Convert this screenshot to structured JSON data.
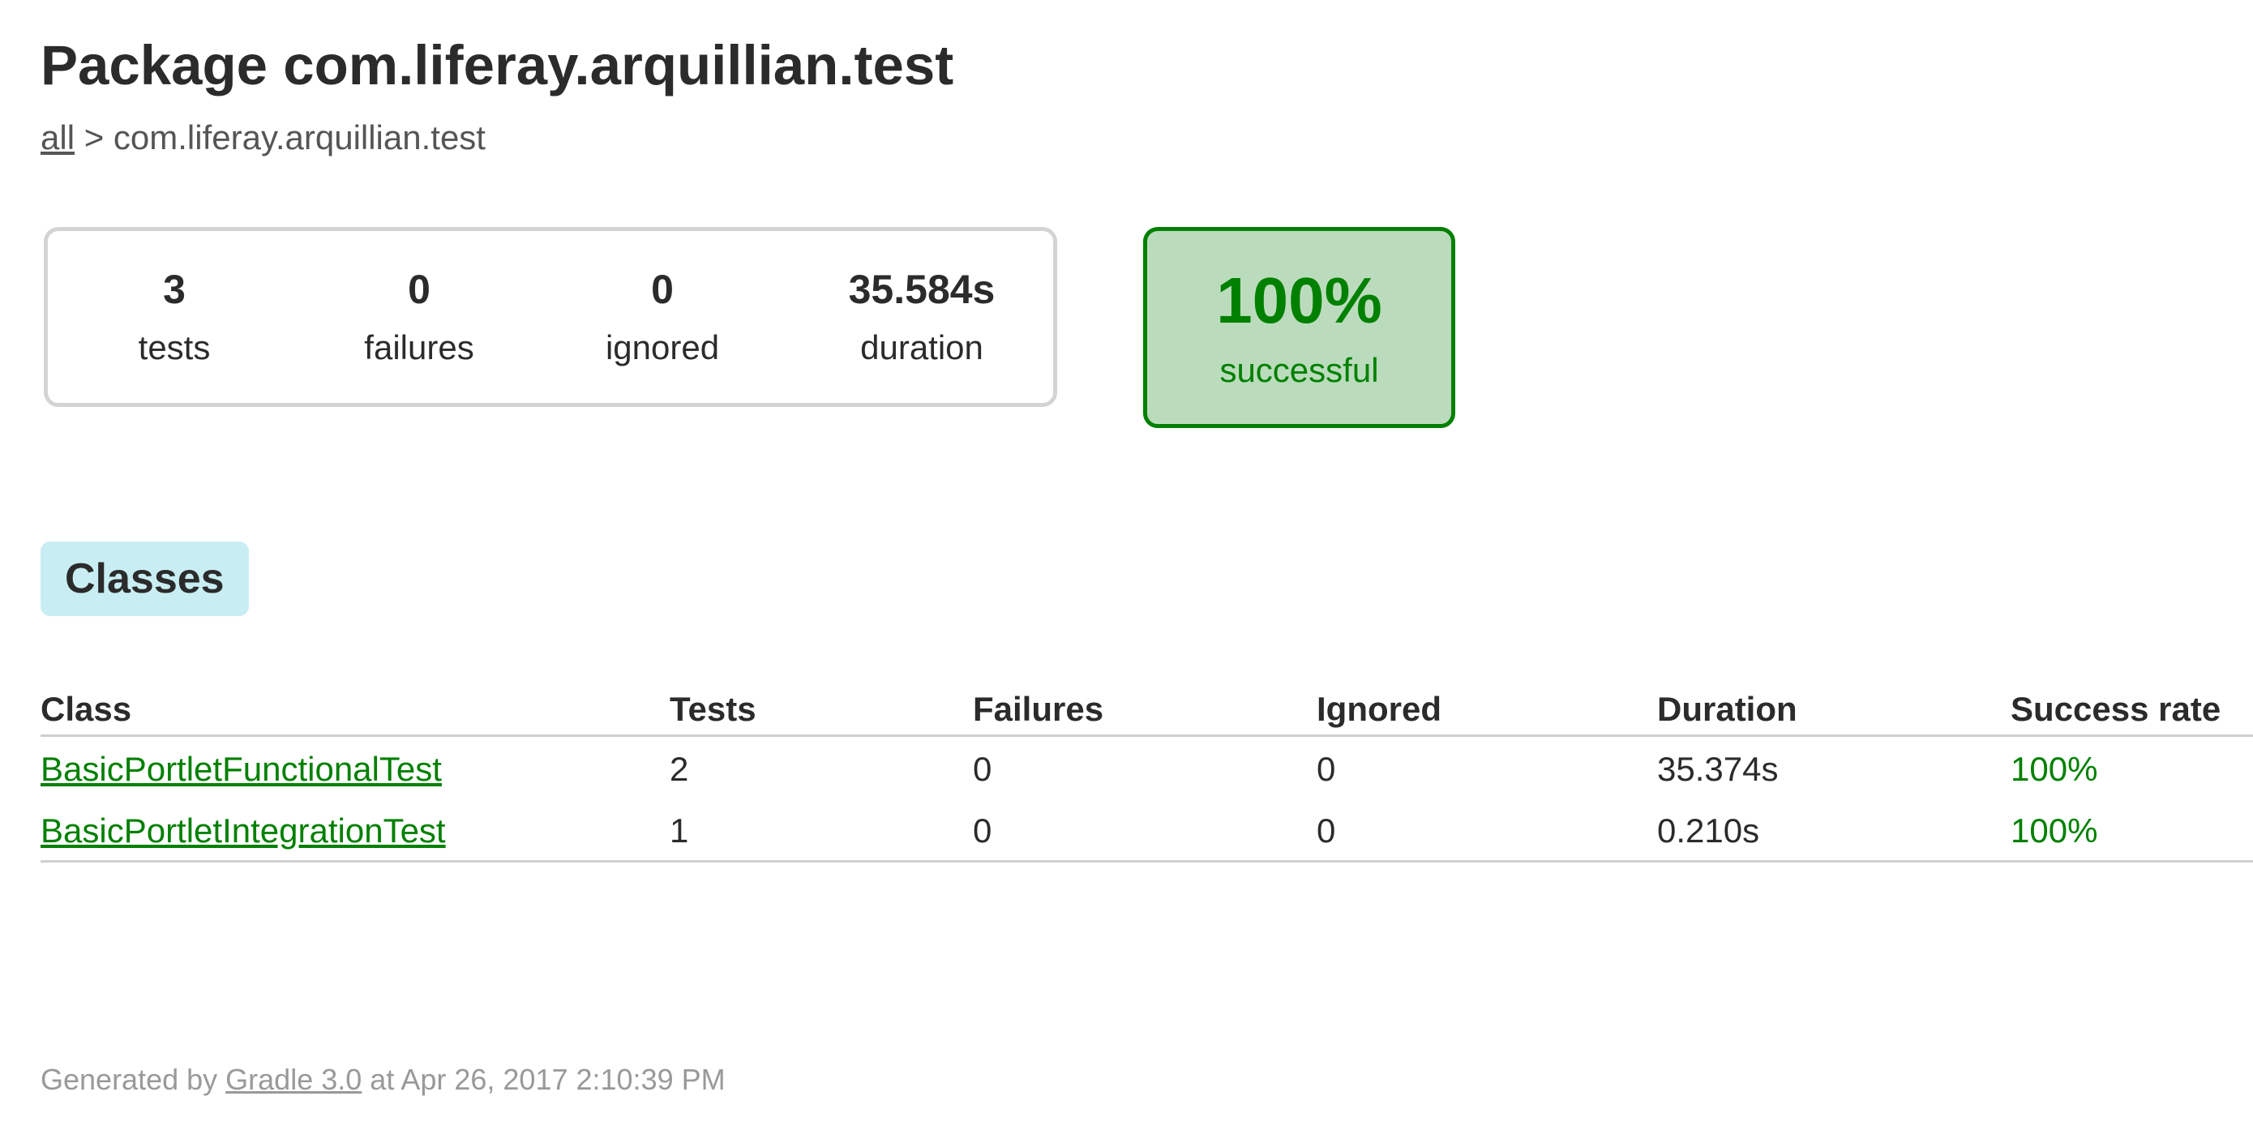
{
  "title": "Package com.liferay.arquillian.test",
  "breadcrumb": {
    "root_link": "all",
    "separator": ">",
    "current": "com.liferay.arquillian.test"
  },
  "summary": {
    "tests": {
      "value": "3",
      "label": "tests"
    },
    "failures": {
      "value": "0",
      "label": "failures"
    },
    "ignored": {
      "value": "0",
      "label": "ignored"
    },
    "duration": {
      "value": "35.584s",
      "label": "duration"
    },
    "success": {
      "value": "100%",
      "label": "successful"
    }
  },
  "tab": {
    "label": "Classes"
  },
  "table": {
    "headers": [
      "Class",
      "Tests",
      "Failures",
      "Ignored",
      "Duration",
      "Success rate"
    ],
    "rows": [
      [
        "BasicPortletFunctionalTest",
        "2",
        "0",
        "0",
        "35.374s",
        "100%"
      ],
      [
        "BasicPortletIntegrationTest",
        "1",
        "0",
        "0",
        "0.210s",
        "100%"
      ]
    ]
  },
  "footer": {
    "prefix": "Generated by",
    "link": "Gradle 3.0",
    "suffix": "at Apr 26, 2017 2:10:39 PM"
  },
  "colors": {
    "success": "#008000",
    "success_bg": "#bbdcbc",
    "tab_bg": "#c8eef3",
    "text": "#2b2b2b",
    "muted": "#999999"
  }
}
